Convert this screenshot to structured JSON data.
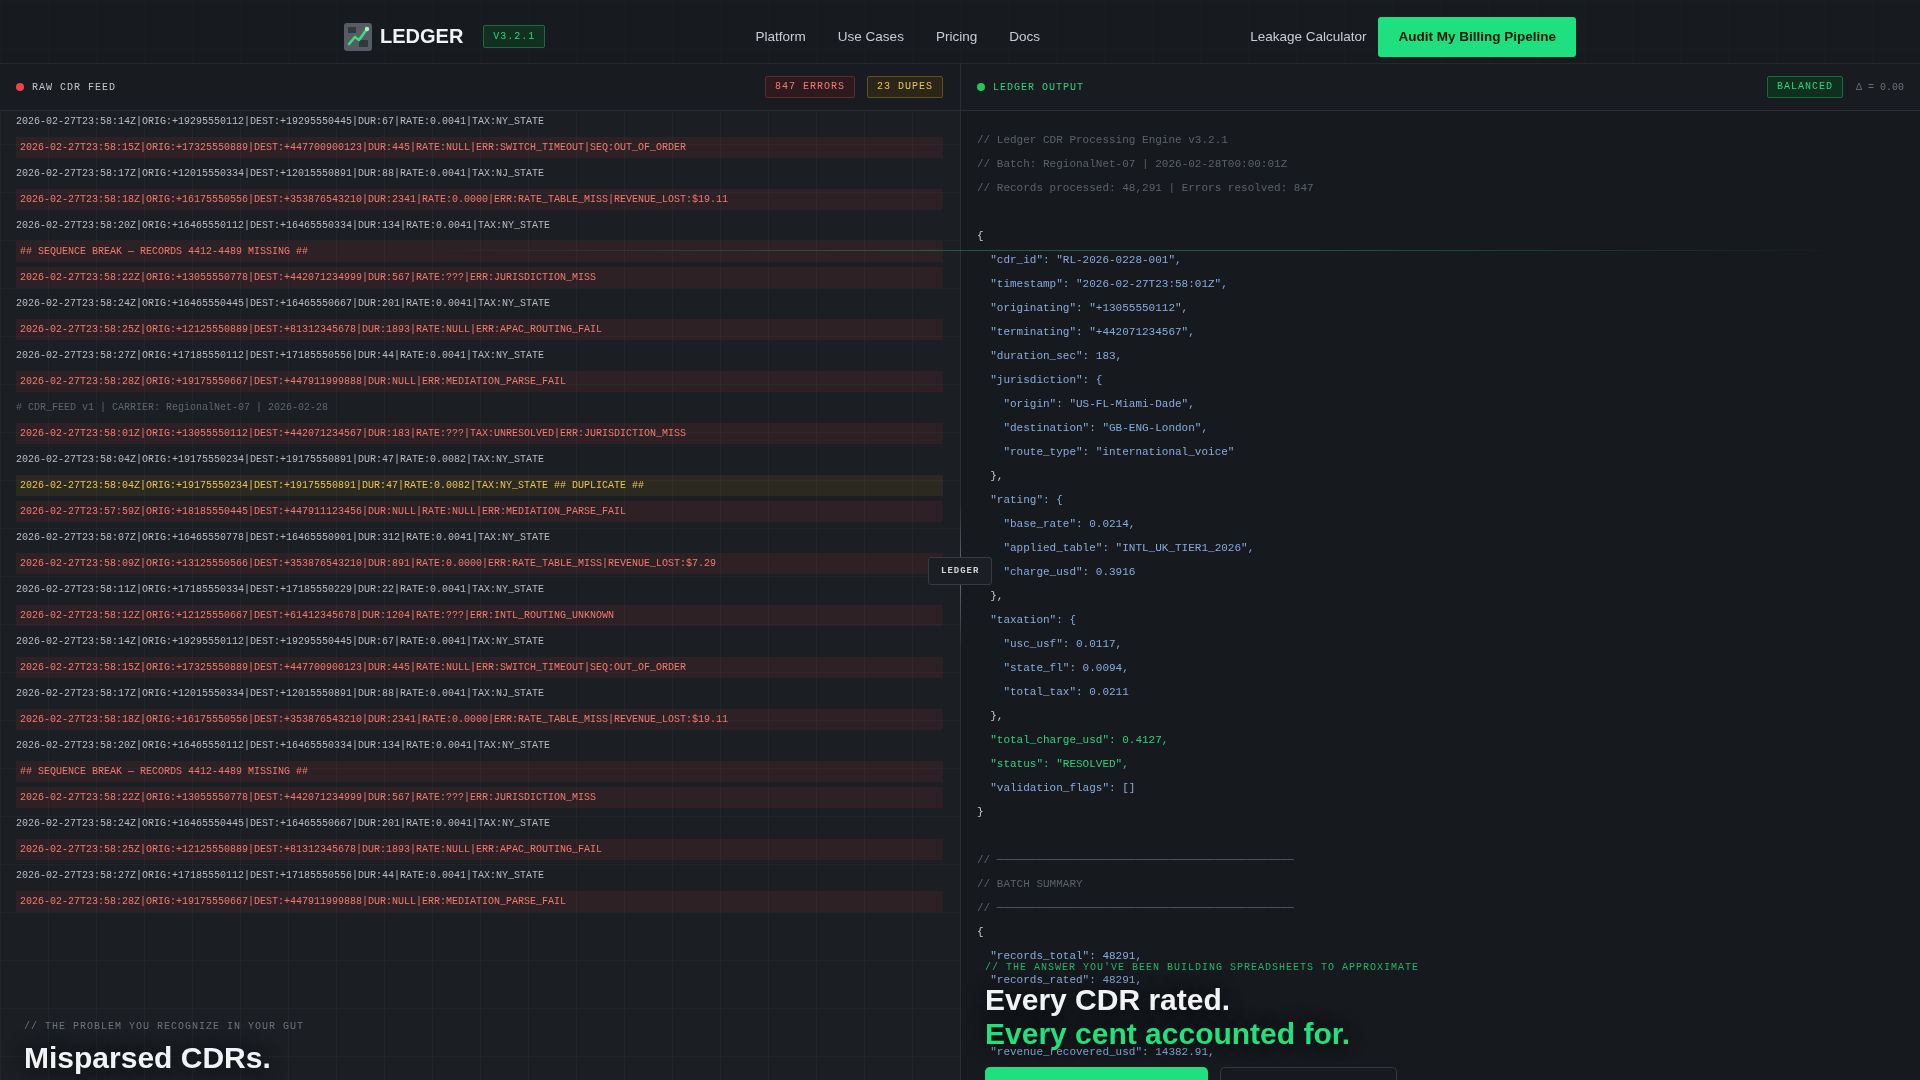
{
  "nav": {
    "brand": "LEDGER",
    "version": "V3.2.1",
    "links": [
      "Platform",
      "Use Cases",
      "Pricing",
      "Docs"
    ],
    "secondary_link": "Leakage Calculator",
    "cta": "Audit My Billing Pipeline"
  },
  "feed_panel": {
    "title": "RAW CDR FEED",
    "badges": [
      {
        "kind": "error",
        "text": "847 ERRORS"
      },
      {
        "kind": "warning",
        "text": "23 DUPES"
      }
    ],
    "rows": [
      {
        "kind": "ok",
        "text": "2026-02-27T23:58:14Z|ORIG:+19295550112|DEST:+19295550445|DUR:67|RATE:0.0041|TAX:NY_STATE"
      },
      {
        "kind": "error",
        "text": "2026-02-27T23:58:15Z|ORIG:+17325550889|DEST:+447700900123|DUR:445|RATE:NULL|ERR:SWITCH_TIMEOUT|SEQ:OUT_OF_ORDER"
      },
      {
        "kind": "ok",
        "text": "2026-02-27T23:58:17Z|ORIG:+12015550334|DEST:+12015550891|DUR:88|RATE:0.0041|TAX:NJ_STATE"
      },
      {
        "kind": "error",
        "text": "2026-02-27T23:58:18Z|ORIG:+16175550556|DEST:+353876543210|DUR:2341|RATE:0.0000|ERR:RATE_TABLE_MISS|REVENUE_LOST:$19.11"
      },
      {
        "kind": "ok",
        "text": "2026-02-27T23:58:20Z|ORIG:+16465550112|DEST:+16465550334|DUR:134|RATE:0.0041|TAX:NY_STATE"
      },
      {
        "kind": "error",
        "text": "## SEQUENCE BREAK — RECORDS 4412-4489 MISSING ##"
      },
      {
        "kind": "error",
        "text": "2026-02-27T23:58:22Z|ORIG:+13055550778|DEST:+442071234999|DUR:567|RATE:???|ERR:JURISDICTION_MISS"
      },
      {
        "kind": "ok",
        "text": "2026-02-27T23:58:24Z|ORIG:+16465550445|DEST:+16465550667|DUR:201|RATE:0.0041|TAX:NY_STATE"
      },
      {
        "kind": "error",
        "text": "2026-02-27T23:58:25Z|ORIG:+12125550889|DEST:+81312345678|DUR:1893|RATE:NULL|ERR:APAC_ROUTING_FAIL"
      },
      {
        "kind": "ok",
        "text": "2026-02-27T23:58:27Z|ORIG:+17185550112|DEST:+17185550556|DUR:44|RATE:0.0041|TAX:NY_STATE"
      },
      {
        "kind": "error",
        "text": "2026-02-27T23:58:28Z|ORIG:+19175550667|DEST:+447911999888|DUR:NULL|ERR:MEDIATION_PARSE_FAIL"
      },
      {
        "kind": "comment",
        "text": "# CDR_FEED v1 | CARRIER: RegionalNet-07 | 2026-02-28"
      },
      {
        "kind": "error",
        "text": "2026-02-27T23:58:01Z|ORIG:+13055550112|DEST:+442071234567|DUR:183|RATE:???|TAX:UNRESOLVED|ERR:JURISDICTION_MISS"
      },
      {
        "kind": "ok",
        "text": "2026-02-27T23:58:04Z|ORIG:+19175550234|DEST:+19175550891|DUR:47|RATE:0.0082|TAX:NY_STATE"
      },
      {
        "kind": "duplicate",
        "text": "2026-02-27T23:58:04Z|ORIG:+19175550234|DEST:+19175550891|DUR:47|RATE:0.0082|TAX:NY_STATE ## DUPLICATE ##"
      },
      {
        "kind": "error",
        "text": "2026-02-27T23:57:59Z|ORIG:+18185550445|DEST:+447911123456|DUR:NULL|RATE:NULL|ERR:MEDIATION_PARSE_FAIL"
      },
      {
        "kind": "ok",
        "text": "2026-02-27T23:58:07Z|ORIG:+16465550778|DEST:+16465550901|DUR:312|RATE:0.0041|TAX:NY_STATE"
      },
      {
        "kind": "error",
        "text": "2026-02-27T23:58:09Z|ORIG:+13125550566|DEST:+353876543210|DUR:891|RATE:0.0000|ERR:RATE_TABLE_MISS|REVENUE_LOST:$7.29"
      },
      {
        "kind": "ok",
        "text": "2026-02-27T23:58:11Z|ORIG:+17185550334|DEST:+17185550229|DUR:22|RATE:0.0041|TAX:NY_STATE"
      },
      {
        "kind": "error",
        "text": "2026-02-27T23:58:12Z|ORIG:+12125550667|DEST:+61412345678|DUR:1204|RATE:???|ERR:INTL_ROUTING_UNKNOWN"
      },
      {
        "kind": "ok",
        "text": "2026-02-27T23:58:14Z|ORIG:+19295550112|DEST:+19295550445|DUR:67|RATE:0.0041|TAX:NY_STATE"
      },
      {
        "kind": "error",
        "text": "2026-02-27T23:58:15Z|ORIG:+17325550889|DEST:+447700900123|DUR:445|RATE:NULL|ERR:SWITCH_TIMEOUT|SEQ:OUT_OF_ORDER"
      },
      {
        "kind": "ok",
        "text": "2026-02-27T23:58:17Z|ORIG:+12015550334|DEST:+12015550891|DUR:88|RATE:0.0041|TAX:NJ_STATE"
      },
      {
        "kind": "error",
        "text": "2026-02-27T23:58:18Z|ORIG:+16175550556|DEST:+353876543210|DUR:2341|RATE:0.0000|ERR:RATE_TABLE_MISS|REVENUE_LOST:$19.11"
      },
      {
        "kind": "ok",
        "text": "2026-02-27T23:58:20Z|ORIG:+16465550112|DEST:+16465550334|DUR:134|RATE:0.0041|TAX:NY_STATE"
      },
      {
        "kind": "error",
        "text": "## SEQUENCE BREAK — RECORDS 4412-4489 MISSING ##"
      },
      {
        "kind": "error",
        "text": "2026-02-27T23:58:22Z|ORIG:+13055550778|DEST:+442071234999|DUR:567|RATE:???|ERR:JURISDICTION_MISS"
      },
      {
        "kind": "ok",
        "text": "2026-02-27T23:58:24Z|ORIG:+16465550445|DEST:+16465550667|DUR:201|RATE:0.0041|TAX:NY_STATE"
      },
      {
        "kind": "error",
        "text": "2026-02-27T23:58:25Z|ORIG:+12125550889|DEST:+81312345678|DUR:1893|RATE:NULL|ERR:APAC_ROUTING_FAIL"
      },
      {
        "kind": "ok",
        "text": "2026-02-27T23:58:27Z|ORIG:+17185550112|DEST:+17185550556|DUR:44|RATE:0.0041|TAX:NY_STATE"
      },
      {
        "kind": "error",
        "text": "2026-02-27T23:58:28Z|ORIG:+19175550667|DEST:+447911999888|DUR:NULL|ERR:MEDIATION_PARSE_FAIL"
      }
    ]
  },
  "divider_label": "LEDGER",
  "output_panel": {
    "title": "LEDGER OUTPUT",
    "badges": [
      {
        "kind": "success",
        "text": "BALANCED"
      }
    ],
    "delta": "Δ = 0.00",
    "code": [
      {
        "kind": "comment",
        "text": "// Ledger CDR Processing Engine v3.2.1"
      },
      {
        "kind": "comment",
        "text": "// Batch: RegionalNet-07 | 2026-02-28T00:00:01Z"
      },
      {
        "kind": "comment",
        "text": "// Records processed: 48,291 | Errors resolved: 847"
      },
      {
        "kind": "spacer"
      },
      {
        "kind": "brace",
        "text": "{",
        "children": [
          {
            "kind": "field",
            "text": "\"cdr_id\": \"RL-2026-0228-001\","
          },
          {
            "kind": "field",
            "text": "\"timestamp\": \"2026-02-27T23:58:01Z\","
          },
          {
            "kind": "field",
            "text": "\"originating\": \"+13055550112\","
          },
          {
            "kind": "field",
            "text": "\"terminating\": \"+442071234567\","
          },
          {
            "kind": "field",
            "text": "\"duration_sec\": 183,"
          },
          {
            "kind": "field",
            "text": "\"jurisdiction\": {",
            "children": [
              {
                "kind": "field",
                "text": "\"origin\": \"US-FL-Miami-Dade\","
              },
              {
                "kind": "field",
                "text": "\"destination\": \"GB-ENG-London\","
              },
              {
                "kind": "field",
                "text": "\"route_type\": \"international_voice\""
              }
            ]
          },
          {
            "kind": "brace",
            "text": "},"
          },
          {
            "kind": "field",
            "text": "\"rating\": {",
            "children": [
              {
                "kind": "field",
                "text": "\"base_rate\": 0.0214,"
              },
              {
                "kind": "field",
                "text": "\"applied_table\": \"INTL_UK_TIER1_2026\","
              },
              {
                "kind": "field",
                "text": "\"charge_usd\": 0.3916"
              }
            ]
          },
          {
            "kind": "brace",
            "text": "},"
          },
          {
            "kind": "field",
            "text": "\"taxation\": {",
            "children": [
              {
                "kind": "field",
                "text": "\"usc_usf\": 0.0117,"
              },
              {
                "kind": "field",
                "text": "\"state_fl\": 0.0094,"
              },
              {
                "kind": "field",
                "text": "\"total_tax\": 0.0211"
              }
            ]
          },
          {
            "kind": "brace",
            "text": "},"
          },
          {
            "kind": "highlight",
            "text": "\"total_charge_usd\": 0.4127,"
          },
          {
            "kind": "highlight",
            "text": "\"status\": \"RESOLVED\","
          },
          {
            "kind": "field",
            "text": "\"validation_flags\": []"
          }
        ]
      },
      {
        "kind": "brace",
        "text": "}"
      },
      {
        "kind": "spacer"
      },
      {
        "kind": "comment",
        "text": "// ─────────────────────────────────────────────"
      },
      {
        "kind": "comment",
        "text": "// BATCH SUMMARY"
      },
      {
        "kind": "comment",
        "text": "// ─────────────────────────────────────────────"
      },
      {
        "kind": "brace",
        "text": "{",
        "children": [
          {
            "kind": "field",
            "text": "\"records_total\": 48291,"
          },
          {
            "kind": "field",
            "text": "\"records_rated\": 48291,"
          },
          {
            "kind": "spacer"
          },
          {
            "kind": "spacer"
          },
          {
            "kind": "field",
            "text": "\"revenue_recovered_usd\": 14382.91,"
          }
        ]
      }
    ]
  },
  "problem_section": {
    "caption": "// THE PROBLEM YOU RECOGNIZE IN YOUR GUT",
    "headline": "Misparsed CDRs."
  },
  "answer_section": {
    "caption": "// THE ANSWER YOU'VE BEEN BUILDING SPREADSHEETS TO APPROXIMATE",
    "headlines": [
      {
        "kind": "plain",
        "text": "Every CDR rated."
      },
      {
        "kind": "accent",
        "text": "Every cent accounted for."
      }
    ],
    "buttons": [
      {
        "kind": "primary"
      },
      {
        "kind": "secondary"
      }
    ]
  }
}
